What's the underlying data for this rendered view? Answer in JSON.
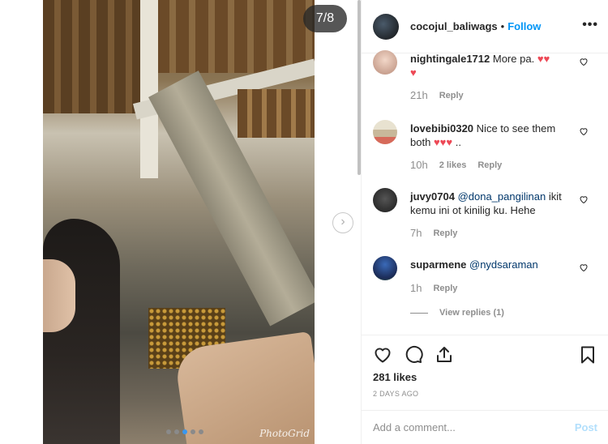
{
  "media": {
    "counter": "7/8",
    "watermark": "PhotoGrid",
    "dots_count": 5,
    "active_dot": 2
  },
  "header": {
    "username": "cocojul_baliwags",
    "separator": "•",
    "follow_label": "Follow",
    "more_label": "•••"
  },
  "comments": [
    {
      "username": "nightingale1712",
      "text": "More pa.",
      "hearts": 3,
      "time": "21h",
      "reply_label": "Reply",
      "likes": ""
    },
    {
      "username": "lovebibi0320",
      "text": "Nice to see them both",
      "hearts": 3,
      "suffix": "..",
      "time": "10h",
      "likes": "2 likes",
      "reply_label": "Reply"
    },
    {
      "username": "juvy0704",
      "mention": "@dona_pangilinan",
      "text": "ikit kemu ini ot kinilig ku. Hehe",
      "time": "7h",
      "reply_label": "Reply",
      "likes": ""
    },
    {
      "username": "suparmene",
      "mention": "@nydsaraman",
      "text": "",
      "time": "1h",
      "reply_label": "Reply",
      "likes": ""
    }
  ],
  "view_replies_label": "View replies (1)",
  "likes_text": "281 likes",
  "date_text": "2 DAYS AGO",
  "add_comment": {
    "placeholder": "Add a comment...",
    "post_label": "Post"
  },
  "colors": {
    "link_blue": "#0095f6",
    "heart_red": "#ed4956",
    "muted": "#8e8e8e"
  }
}
